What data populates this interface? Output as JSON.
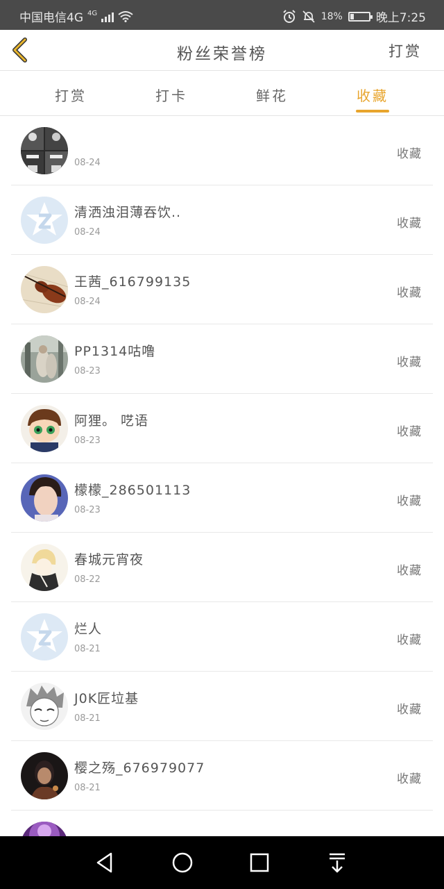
{
  "status_bar": {
    "carrier": "中国电信4G",
    "network": "4G",
    "battery": "18%",
    "time": "晚上7:25"
  },
  "header": {
    "title": "粉丝荣誉榜",
    "action_label": "打赏"
  },
  "tabs": [
    {
      "label": "打赏"
    },
    {
      "label": "打卡"
    },
    {
      "label": "鲜花"
    },
    {
      "label": "收藏"
    }
  ],
  "active_tab": "收藏",
  "colors": {
    "accent": "#e8a52d",
    "status_bar_bg": "#4a4a4a",
    "nav_bar_bg": "#000000"
  },
  "fans": [
    {
      "name": "",
      "date": "08-24",
      "type": "收藏",
      "avatar": "group-photo"
    },
    {
      "name": "清洒浊泪薄吞饮..",
      "date": "08-24",
      "type": "收藏",
      "avatar": "default-qq"
    },
    {
      "name": "王茜_616799135",
      "date": "08-24",
      "type": "收藏",
      "avatar": "violin"
    },
    {
      "name": "PP1314咕噜",
      "date": "08-23",
      "type": "收藏",
      "avatar": "street-photo"
    },
    {
      "name": "阿狸。 呓语",
      "date": "08-23",
      "type": "收藏",
      "avatar": "cartoon-boy"
    },
    {
      "name": "檬檬_286501113",
      "date": "08-23",
      "type": "收藏",
      "avatar": "portrait"
    },
    {
      "name": "春城元宵夜",
      "date": "08-22",
      "type": "收藏",
      "avatar": "anime-sketch"
    },
    {
      "name": "烂人",
      "date": "08-21",
      "type": "收藏",
      "avatar": "default-qq"
    },
    {
      "name": "J0K匠垃基",
      "date": "08-21",
      "type": "收藏",
      "avatar": "anime-face"
    },
    {
      "name": "樱之殇_676979077",
      "date": "08-21",
      "type": "收藏",
      "avatar": "dark-portrait"
    },
    {
      "name": "",
      "date": "",
      "type": "",
      "avatar": "purple-photo"
    }
  ],
  "system_nav": [
    "back-icon",
    "home-icon",
    "recents-icon",
    "notification-pull-icon"
  ]
}
